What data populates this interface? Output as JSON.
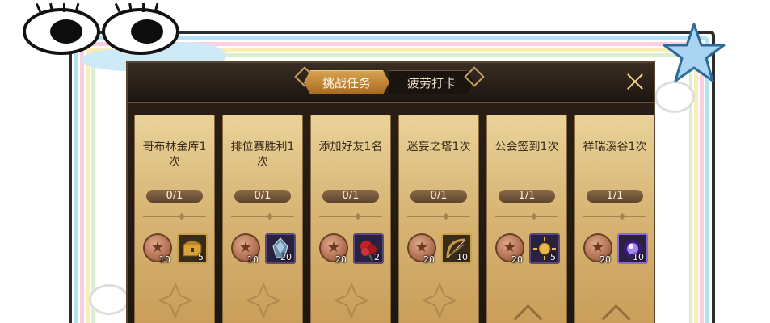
{
  "tabs": [
    {
      "label": "挑战任务",
      "active": true
    },
    {
      "label": "疲劳打卡",
      "active": false
    }
  ],
  "tasks": [
    {
      "title": "哥布林金库1次",
      "progress": "0/1",
      "coin_count": "10",
      "item_count": "5",
      "item_icon": "golden-chest-icon"
    },
    {
      "title": "排位赛胜利1次",
      "progress": "0/1",
      "coin_count": "10",
      "item_count": "20",
      "item_icon": "crystal-shard-icon"
    },
    {
      "title": "添加好友1名",
      "progress": "0/1",
      "coin_count": "20",
      "item_count": "2",
      "item_icon": "red-rose-icon"
    },
    {
      "title": "迷妄之塔1次",
      "progress": "0/1",
      "coin_count": "20",
      "item_count": "10",
      "item_icon": "bow-icon"
    },
    {
      "title": "公会签到1次",
      "progress": "1/1",
      "coin_count": "20",
      "item_count": "5",
      "item_icon": "golden-sun-icon"
    },
    {
      "title": "祥瑞溪谷1次",
      "progress": "1/1",
      "coin_count": "20",
      "item_count": "10",
      "item_icon": "purple-orb-icon"
    }
  ],
  "colors": {
    "panel_bg": "#1e1812",
    "tab_active": "#c68a3a",
    "card_bg": "#d9b878",
    "accent_gold": "#f3d28a"
  }
}
